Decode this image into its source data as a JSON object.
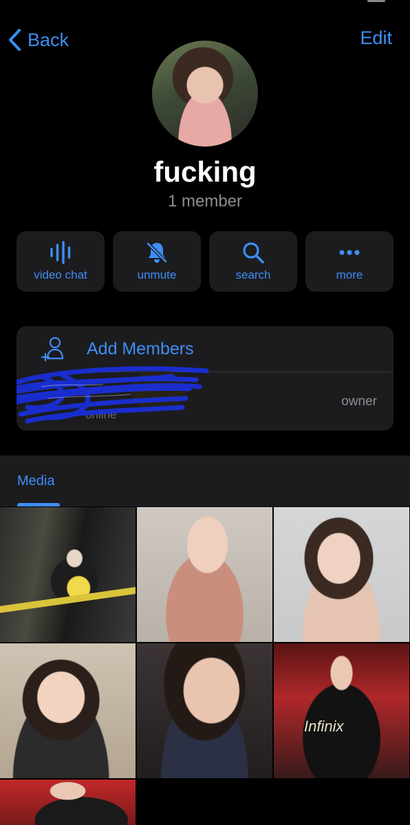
{
  "nav": {
    "back_label": "Back",
    "edit_label": "Edit"
  },
  "group": {
    "title": "fucking",
    "subtitle": "1 member"
  },
  "actions": [
    {
      "label": "video chat",
      "icon": "waveform-icon"
    },
    {
      "label": "unmute",
      "icon": "bell-slash-icon"
    },
    {
      "label": "search",
      "icon": "search-icon"
    },
    {
      "label": "more",
      "icon": "more-icon"
    }
  ],
  "members": {
    "add_label": "Add Members",
    "items": [
      {
        "role": "owner",
        "name": "online"
      }
    ]
  },
  "media": {
    "tab_label": "Media",
    "tiles": [
      {
        "overlay_text": ""
      },
      {
        "overlay_text": ""
      },
      {
        "overlay_text": ""
      },
      {
        "overlay_text": ""
      },
      {
        "overlay_text": ""
      },
      {
        "overlay_text": "Infinix"
      },
      {
        "overlay_text": ""
      }
    ]
  },
  "colors": {
    "accent": "#3e8ef7",
    "background": "#000000",
    "card": "#1c1c1e",
    "secondary_text": "#8e8e93",
    "redaction": "#1a2fd6"
  }
}
